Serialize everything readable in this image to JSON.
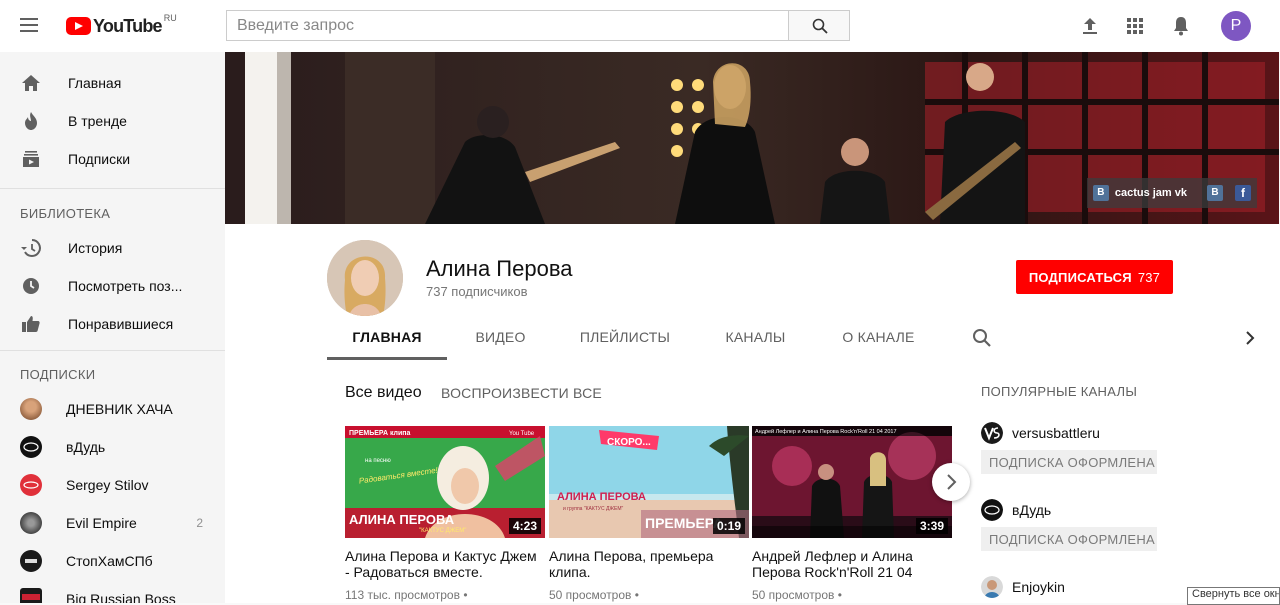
{
  "header": {
    "logo_word": "YouTube",
    "logo_region": "RU",
    "search_placeholder": "Введите запрос",
    "avatar_letter": "P"
  },
  "sidebar": {
    "main": [
      {
        "label": "Главная",
        "icon": "home-icon"
      },
      {
        "label": "В тренде",
        "icon": "trending-icon"
      },
      {
        "label": "Подписки",
        "icon": "subscriptions-icon"
      }
    ],
    "library_heading": "БИБЛИОТЕКА",
    "library": [
      {
        "label": "История",
        "icon": "history-icon"
      },
      {
        "label": "Посмотреть поз...",
        "icon": "clock-icon"
      },
      {
        "label": "Понравившиеся",
        "icon": "thumbs-up-icon"
      }
    ],
    "subs_heading": "ПОДПИСКИ",
    "subscriptions": [
      {
        "label": "ДНЕВНИК ХАЧА",
        "count": "",
        "color": "#b0703c"
      },
      {
        "label": "вДудь",
        "count": "",
        "color": "#111111"
      },
      {
        "label": "Sergey Stilov",
        "count": "",
        "color": "#e0303a"
      },
      {
        "label": "Evil Empire",
        "count": "2",
        "color": "#555555"
      },
      {
        "label": "СтопХамСПб",
        "count": "",
        "color": "#1a1a1a"
      },
      {
        "label": "Big Russian Boss",
        "count": "",
        "color": "#1a1a1a"
      }
    ]
  },
  "banner": {
    "link_text": "cactus jam vk",
    "vk_label": "B",
    "vk2_label": "B",
    "fb_label": "f"
  },
  "channel": {
    "name": "Алина Перова",
    "subscribers": "737 подписчиков",
    "subscribe_label": "ПОДПИСАТЬСЯ",
    "subscribe_count": "737",
    "tabs": [
      "ГЛАВНАЯ",
      "ВИДЕО",
      "ПЛЕЙЛИСТЫ",
      "КАНАЛЫ",
      "О КАНАЛЕ"
    ]
  },
  "section": {
    "title": "Все видео",
    "play_all": "ВОСПРОИЗВЕСТИ ВСЕ"
  },
  "videos": [
    {
      "title": "Алина Перова и Кактус Джем - Радоваться вместе.",
      "duration": "4:23",
      "meta": "113 тыс. просмотров •",
      "thumb_text_top": "ПРЕМЬЕРА клипа",
      "thumb_text_mid": "на песню",
      "thumb_text_song": "Радоваться вместе!",
      "thumb_text_name": "АЛИНА ПЕРОВА",
      "thumb_text_band": "\"КАКТУС ДЖЕМ\"",
      "thumb_text_brand": "You Tube"
    },
    {
      "title": "Алина Перова, премьера клипа.",
      "duration": "0:19",
      "meta": "50 просмотров •",
      "thumb_text_soon": "СКОРО...",
      "thumb_text_name": "АЛИНА ПЕРОВА",
      "thumb_text_band": "и группа \"КАКТУС ДЖЕМ\"",
      "thumb_text_prem": "ПРЕМЬЕРА"
    },
    {
      "title": "Андрей Лефлер и Алина Перова Rock'n'Roll 21 04",
      "duration": "3:39",
      "meta": "50 просмотров •",
      "thumb_text_top": "Андрей Лефлер и Алина Перова Rock'n'Roll 21 04 2017"
    }
  ],
  "popular": {
    "heading": "ПОПУЛЯРНЫЕ КАНАЛЫ",
    "button_label": "ПОДПИСКА ОФОРМЛЕНА",
    "channels": [
      {
        "name": "versusbattleru"
      },
      {
        "name": "вДудь"
      },
      {
        "name": "Enjoykin"
      }
    ]
  },
  "tooltip": "Свернуть все окна"
}
